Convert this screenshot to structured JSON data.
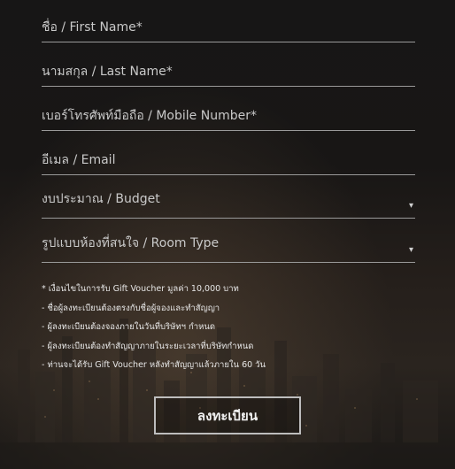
{
  "form": {
    "fields": [
      {
        "label": "ชื่อ / First Name*"
      },
      {
        "label": "นามสกุล / Last Name*"
      },
      {
        "label": "เบอร์โทรศัพท์มือถือ / Mobile Number*"
      },
      {
        "label": "อีเมล / Email"
      },
      {
        "label": "งบประมาณ / Budget",
        "caret": "▾"
      },
      {
        "label": "รูปแบบห้องที่สนใจ / Room Type",
        "caret": "▾"
      }
    ],
    "notes": [
      "* เงื่อนไขในการรับ Gift Voucher มูลค่า 10,000 บาท",
      "- ชื่อผู้ลงทะเบียนต้องตรงกับชื่อผู้จองและทำสัญญา",
      "- ผู้ลงทะเบียนต้องจองภายในวันที่บริษัทฯ กำหนด",
      "- ผู้ลงทะเบียนต้องทำสัญญาภายในระยะเวลาที่บริษัทกำหนด",
      "- ท่านจะได้รับ Gift Voucher หลังทำสัญญาแล้วภายใน 60 วัน"
    ],
    "submit_label": "ลงทะเบียน"
  },
  "colors": {
    "underline": "#9a9a9a",
    "text": "#c9c9c9",
    "button_border": "#bdbdbd"
  },
  "icons": {
    "select_caret": "triangle-down-icon"
  }
}
